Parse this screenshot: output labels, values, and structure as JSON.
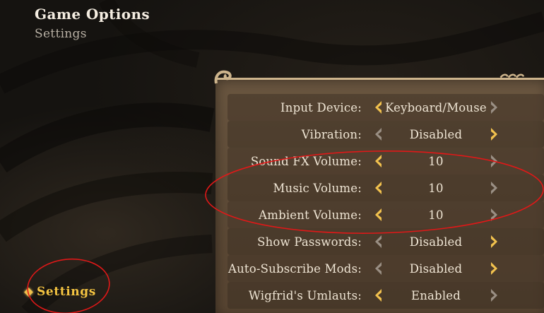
{
  "header": {
    "title": "Game Options",
    "subtitle": "Settings"
  },
  "settings": [
    {
      "label": "Input Device:",
      "value": "Keyboard/Mouse",
      "left_arrow": "active",
      "right_arrow": "inactive"
    },
    {
      "label": "Vibration:",
      "value": "Disabled",
      "left_arrow": "inactive",
      "right_arrow": "active"
    },
    {
      "label": "Sound FX Volume:",
      "value": "10",
      "left_arrow": "active",
      "right_arrow": "inactive"
    },
    {
      "label": "Music Volume:",
      "value": "10",
      "left_arrow": "active",
      "right_arrow": "inactive"
    },
    {
      "label": "Ambient Volume:",
      "value": "10",
      "left_arrow": "active",
      "right_arrow": "inactive"
    },
    {
      "label": "Show Passwords:",
      "value": "Disabled",
      "left_arrow": "inactive",
      "right_arrow": "active"
    },
    {
      "label": "Auto-Subscribe Mods:",
      "value": "Disabled",
      "left_arrow": "inactive",
      "right_arrow": "active"
    },
    {
      "label": "Wigfrid's Umlauts:",
      "value": "Enabled",
      "left_arrow": "active",
      "right_arrow": "inactive"
    }
  ],
  "nav": {
    "current_label": "Settings"
  },
  "colors": {
    "background": "#151310",
    "panel": "#5e4b37",
    "text": "#efe5d4",
    "accent_gold": "#f3c341",
    "arrow_active": "#f2c24e",
    "arrow_inactive": "#9a8f84",
    "annotation_red": "#e01818"
  },
  "icons": {
    "left_arrow": "chevron-left-icon",
    "right_arrow": "chevron-right-icon",
    "nav_marker": "diamond-icon"
  }
}
